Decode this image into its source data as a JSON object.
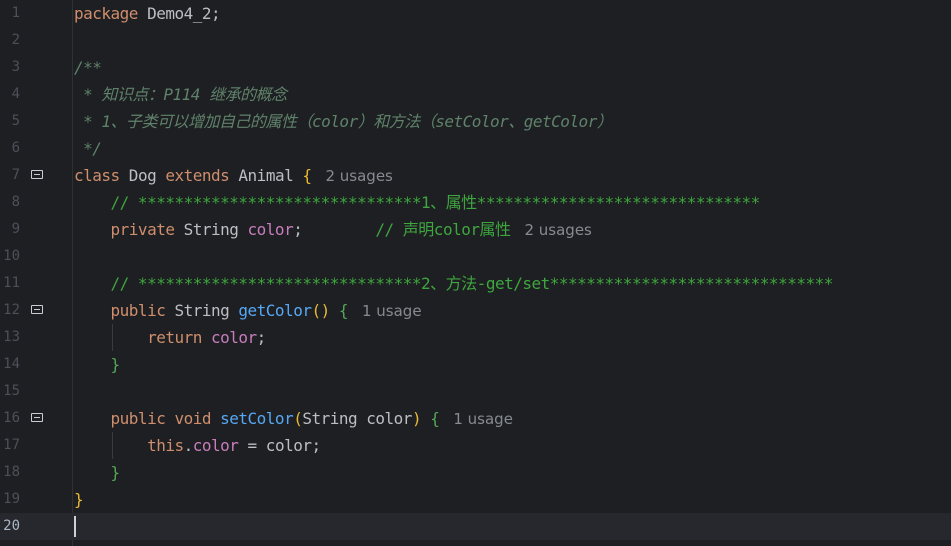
{
  "editor": {
    "line_numbers": [
      "1",
      "2",
      "3",
      "4",
      "5",
      "6",
      "7",
      "8",
      "9",
      "10",
      "11",
      "12",
      "13",
      "14",
      "15",
      "16",
      "17",
      "18",
      "19",
      "20"
    ],
    "current_line": "20",
    "tokens": {
      "l1_kw": "package",
      "l1_rest": " Demo4_2;",
      "l3": "/**",
      "l4": " * 知识点：P114 继承的概念",
      "l5": " * 1、子类可以增加自己的属性（color）和方法（setColor、getColor）",
      "l6": " */",
      "l7_kw1": "class",
      "l7_name": " Dog ",
      "l7_kw2": "extends",
      "l7_parent": " Animal ",
      "l7_brace": "{",
      "l8": "    // *******************************1、属性*******************************",
      "l9_kw": "    private",
      "l9_type": " String ",
      "l9_field": "color",
      "l9_semi": ";",
      "l9_comment": "        // 声明color属性",
      "l11": "    // *******************************2、方法-get/set*******************************",
      "l12_kw": "    public",
      "l12_type": " String ",
      "l12_fn": "getColor",
      "l12_paren": "()",
      "l12_brace": " {",
      "l13_kw": "        return",
      "l13_sp": " ",
      "l13_field": "color",
      "l13_semi": ";",
      "l14": "    }",
      "l16_kw1": "    public",
      "l16_kw2": " void",
      "l16_fn": " setColor",
      "l16_paren_open": "(",
      "l16_params": "String color",
      "l16_paren_close": ")",
      "l16_brace": " {",
      "l17_kw": "        this",
      "l17_dot": ".",
      "l17_field": "color",
      "l17_rest": " = color;",
      "l18": "    }",
      "l19": "}"
    },
    "hints": {
      "class_usages": "2 usages",
      "field_usages": "2 usages",
      "getter_usages": "1 usage",
      "setter_usages": "1 usage"
    }
  },
  "colors": {
    "background": "#1e1f22",
    "keyword": "#cf8e6d",
    "field": "#c77dbb",
    "function": "#56a8f5",
    "comment": "#7a7e85",
    "line_comment": "#3ea63e"
  }
}
